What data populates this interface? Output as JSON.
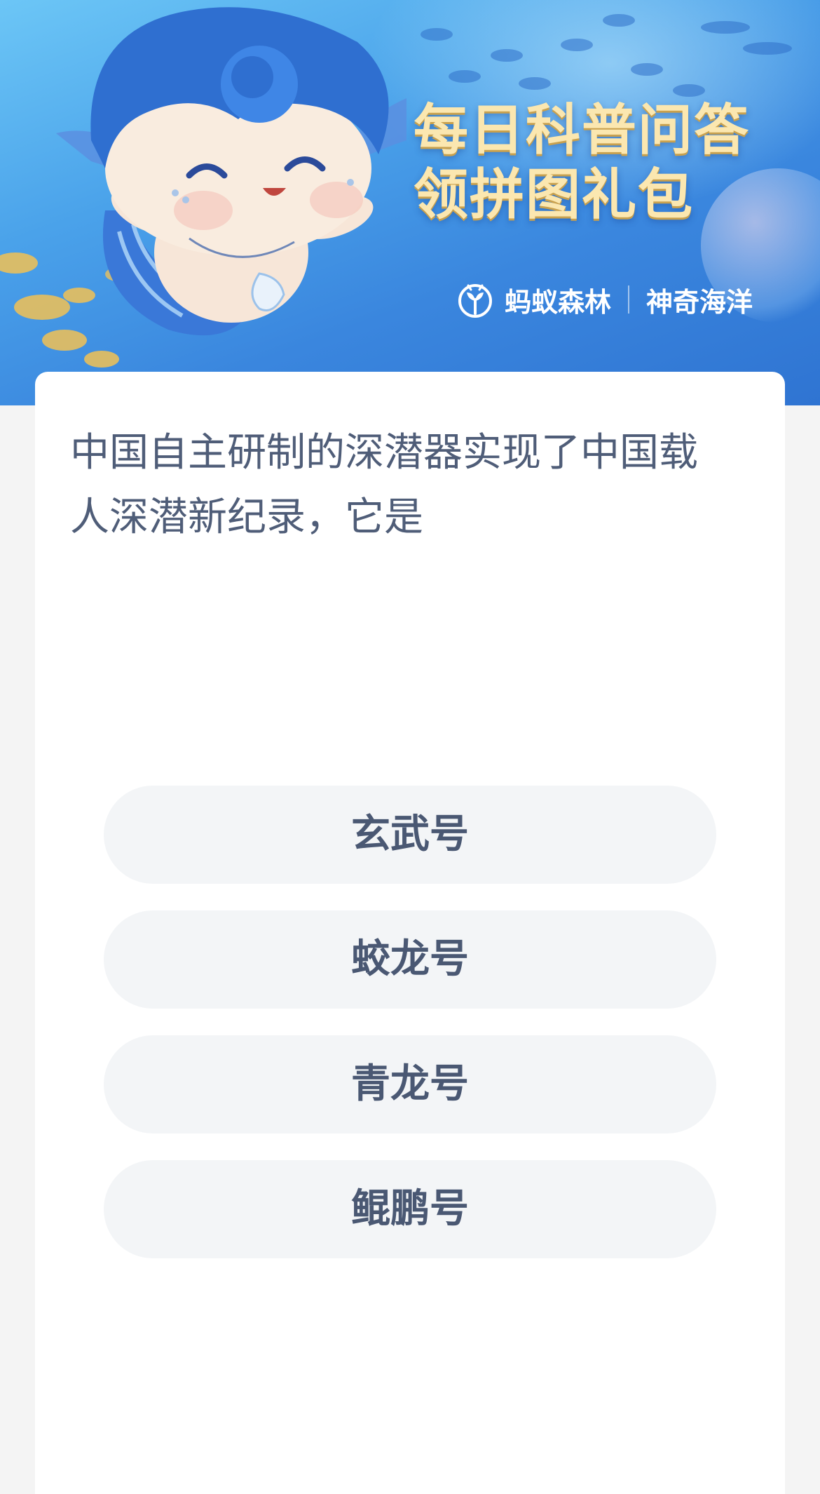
{
  "banner": {
    "title_line1": "每日科普问答",
    "title_line2": "领拼图礼包",
    "brand_name": "蚂蚁森林",
    "brand_sub": "神奇海洋",
    "logo_icon": "sprout-circle-icon",
    "mascot": "mermaid-mascot"
  },
  "quiz": {
    "question": "中国自主研制的深潜器实现了中国载人深潜新纪录，它是",
    "options": [
      {
        "label": "玄武号"
      },
      {
        "label": "蛟龙号"
      },
      {
        "label": "青龙号"
      },
      {
        "label": "鲲鹏号"
      }
    ]
  },
  "colors": {
    "banner_blue": "#3a86de",
    "title_gold": "#fbe7b0",
    "question_text": "#4f5d78",
    "option_bg": "#f3f5f7",
    "option_text": "#4a5873",
    "page_bg": "#f4f4f4"
  }
}
